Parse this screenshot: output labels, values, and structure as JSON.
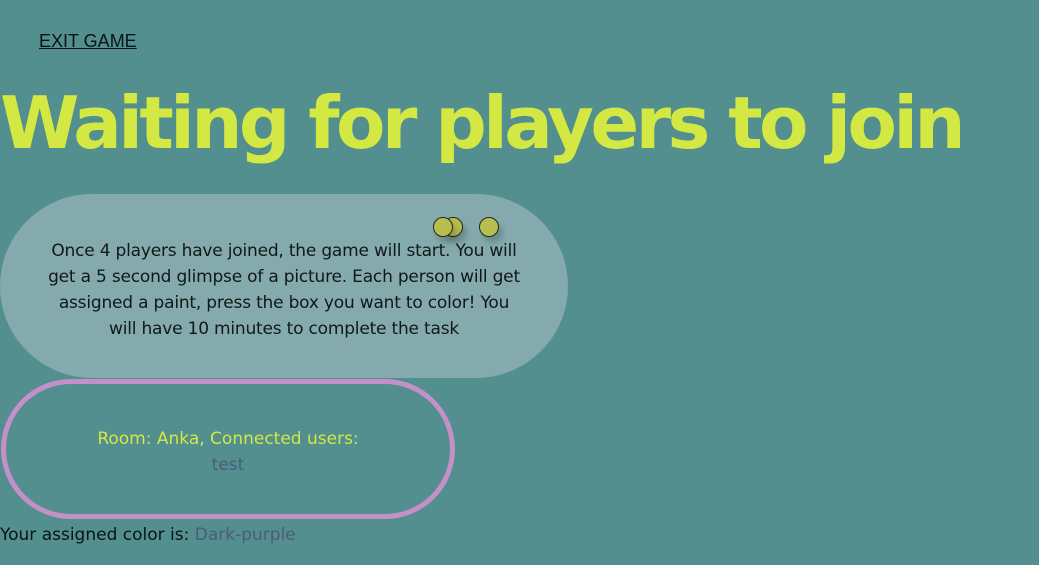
{
  "header": {
    "exit_label": "EXIT GAME",
    "title": "Waiting for players to join"
  },
  "info": {
    "text": "Once 4 players have joined, the game will start. You will get a 5 second glimpse of a picture. Each person will get assigned a paint, press the box you want to color! You will have 10 minutes to complete the task"
  },
  "room": {
    "label": "Room: Anka, Connected users:",
    "users": [
      "test"
    ]
  },
  "assignment": {
    "label": "Your assigned color is:",
    "color_name": "Dark-purple"
  },
  "colors": {
    "background": "#528f8e",
    "title": "#d4e843",
    "info_card": "#84aaad",
    "room_border": "#c490c8",
    "dot": "#b7bd4f",
    "assigned_color_text": "#4e5b7c"
  }
}
